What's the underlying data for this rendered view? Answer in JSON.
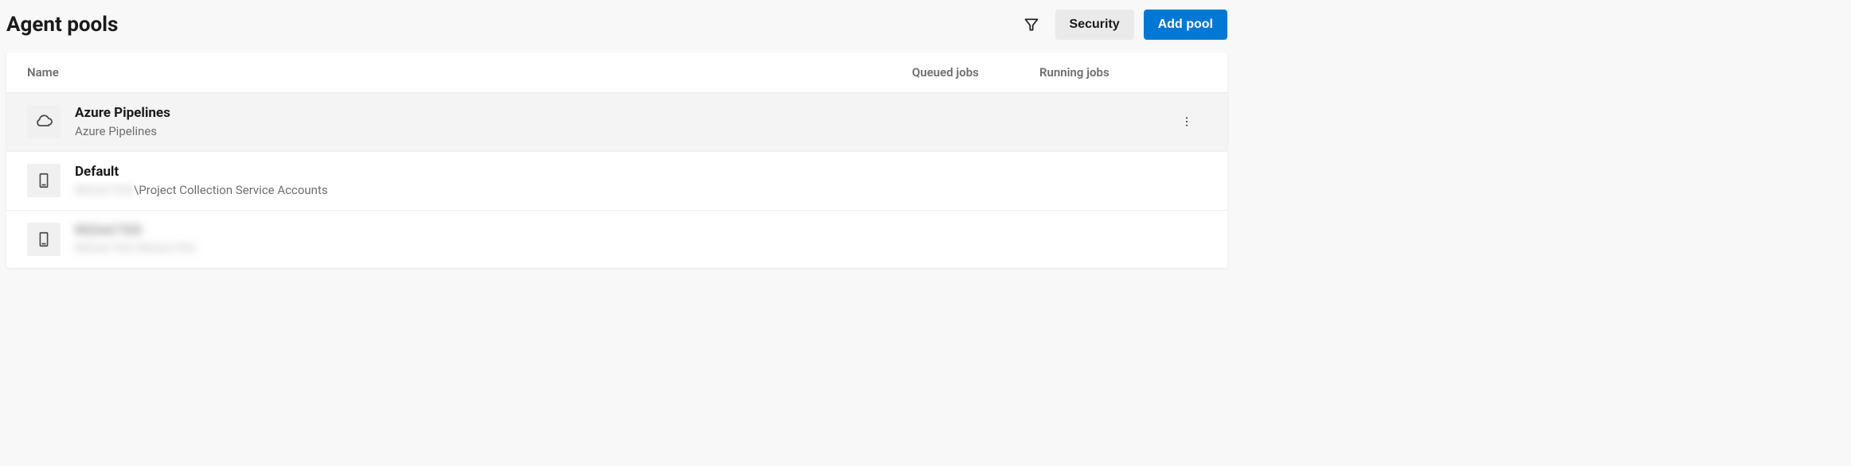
{
  "header": {
    "title": "Agent pools",
    "security_label": "Security",
    "add_pool_label": "Add pool"
  },
  "table": {
    "columns": {
      "name": "Name",
      "queued_jobs": "Queued jobs",
      "running_jobs": "Running jobs"
    },
    "rows": [
      {
        "icon": "cloud",
        "title": "Azure Pipelines",
        "subtitle_prefix": "",
        "subtitle": "Azure Pipelines",
        "queued": "",
        "running": "",
        "show_actions": true,
        "hovered": true,
        "blurred": false
      },
      {
        "icon": "server",
        "title": "Default",
        "subtitle_prefix": "REDACTED",
        "subtitle": "\\Project Collection Service Accounts",
        "queued": "",
        "running": "",
        "show_actions": false,
        "hovered": false,
        "blurred": false
      },
      {
        "icon": "server",
        "title": "REDACTED",
        "subtitle_prefix": "",
        "subtitle": "REDACTED REDACTED",
        "queued": "",
        "running": "",
        "show_actions": false,
        "hovered": false,
        "blurred": true
      }
    ]
  }
}
